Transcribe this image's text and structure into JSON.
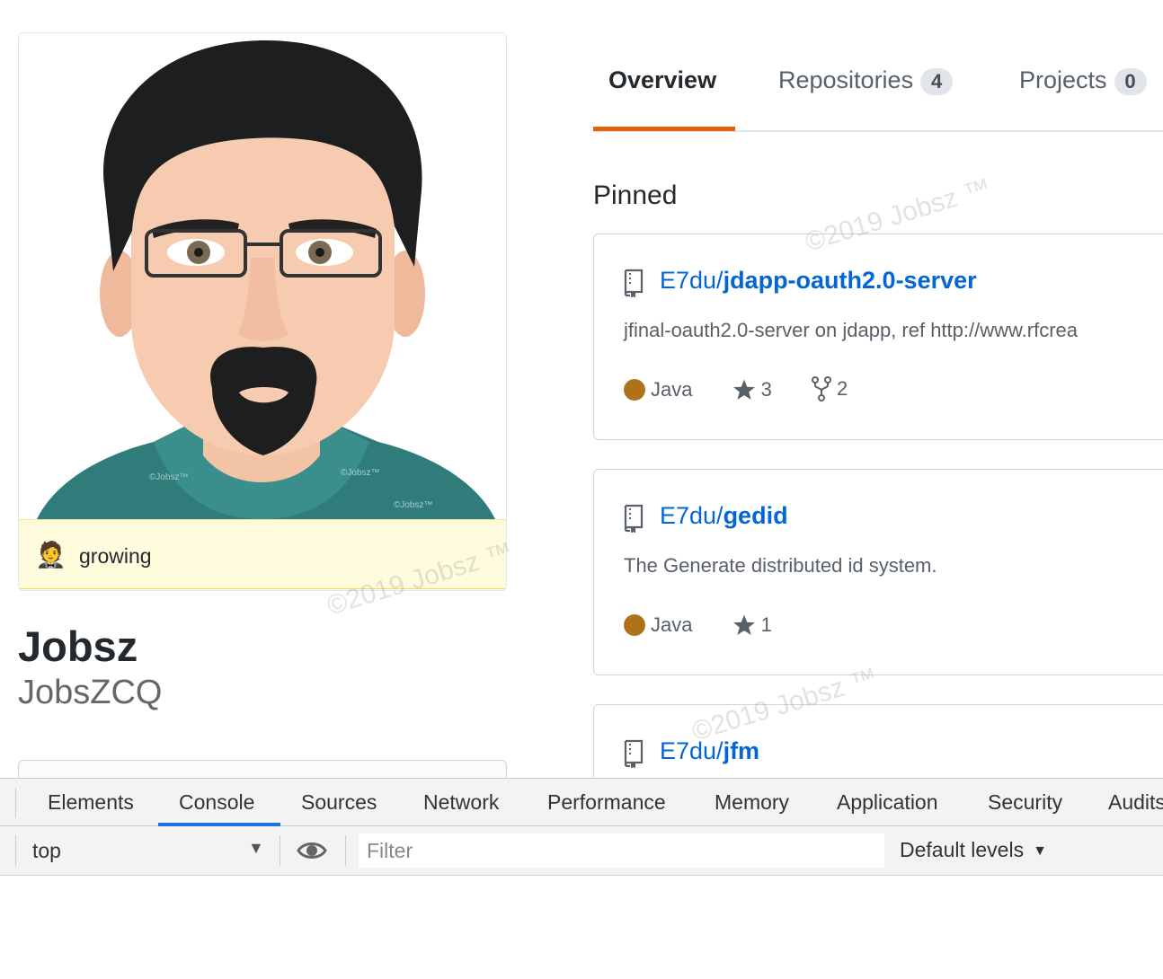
{
  "profile": {
    "status_emoji": "🤵",
    "status_text": "growing",
    "name": "Jobsz",
    "login": "JobsZCQ"
  },
  "avatar": {
    "watermarks": [
      "©Jobsz™",
      "©Jobsz™",
      "©Jobsz™"
    ]
  },
  "tabs": [
    {
      "label": "Overview",
      "selected": true
    },
    {
      "label": "Repositories",
      "count": "4"
    },
    {
      "label": "Projects",
      "count": "0"
    }
  ],
  "pinned": {
    "title": "Pinned",
    "repos": [
      {
        "owner": "E7du/",
        "name": "jdapp-oauth2.0-server",
        "description": "jfinal-oauth2.0-server on jdapp, ref http://www.rfcrea",
        "language": "Java",
        "language_color": "#b07219",
        "stars": "3",
        "forks": "2"
      },
      {
        "owner": "E7du/",
        "name": "gedid",
        "description": "The Generate distributed id system.",
        "language": "Java",
        "language_color": "#b07219",
        "stars": "1"
      },
      {
        "owner": "E7du/",
        "name": "jfm"
      }
    ]
  },
  "watermarks": [
    "©2019 Jobsz ™",
    "©2019 Jobsz ™",
    "©2019 Jobsz ™"
  ],
  "devtools": {
    "tabs": [
      "Elements",
      "Console",
      "Sources",
      "Network",
      "Performance",
      "Memory",
      "Application",
      "Security",
      "Audits"
    ],
    "active_tab": "Console",
    "context": "top",
    "filter_placeholder": "Filter",
    "levels": "Default levels"
  }
}
